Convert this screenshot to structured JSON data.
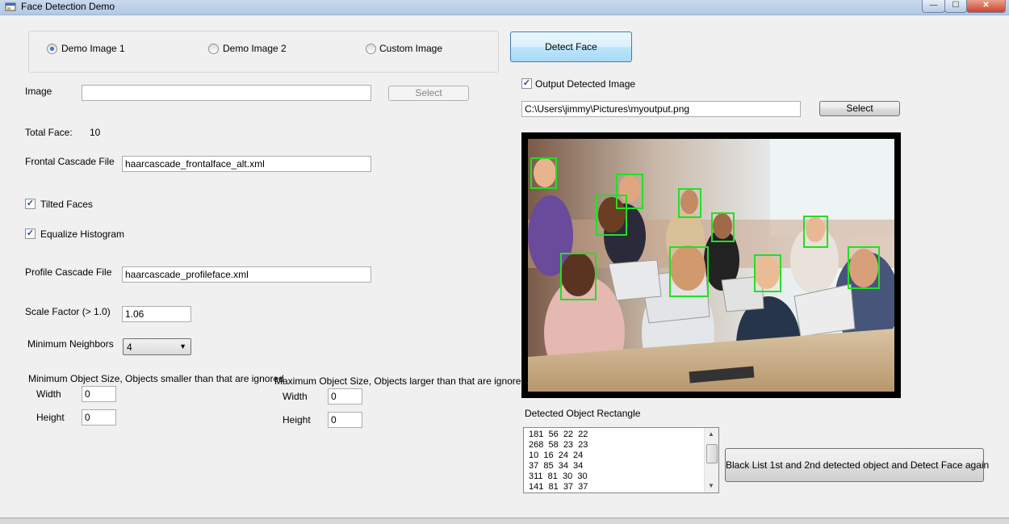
{
  "window": {
    "title": "Face Detection Demo",
    "minimize_glyph": "—",
    "maximize_glyph": "☐",
    "close_glyph": "✕"
  },
  "source": {
    "options": [
      "Demo Image 1",
      "Demo Image 2",
      "Custom Image"
    ],
    "selected": "Demo Image 1"
  },
  "detect_button": "Detect Face",
  "image": {
    "label": "Image",
    "value": "",
    "select_label": "Select"
  },
  "total_face": {
    "label": "Total Face:",
    "value": "10"
  },
  "frontal": {
    "label": "Frontal Cascade File",
    "value": "haarcascade_frontalface_alt.xml"
  },
  "tilted": {
    "label": "Tilted Faces",
    "checked": true
  },
  "equalize": {
    "label": "Equalize Histogram",
    "checked": true
  },
  "profile": {
    "label": "Profile Cascade File",
    "value": "haarcascade_profileface.xml"
  },
  "scale": {
    "label": "Scale Factor (> 1.0)",
    "value": "1.06"
  },
  "neighbors": {
    "label": "Minimum Neighbors",
    "value": "4"
  },
  "min_size": {
    "caption": "Minimum Object Size, Objects smaller than that are ignored",
    "width_label": "Width",
    "width": "0",
    "height_label": "Height",
    "height": "0"
  },
  "max_size": {
    "caption": "Maximum Object Size, Objects larger than that are ignored",
    "width_label": "Width",
    "width": "0",
    "height_label": "Height",
    "height": "0"
  },
  "output": {
    "label": "Output Detected Image",
    "checked": true,
    "path": "C:\\Users\\jimmy\\Pictures\\myoutput.png",
    "select_label": "Select"
  },
  "detected": {
    "label": "Detected Object Rectangle",
    "rows": [
      "181  56  22  22",
      "268  58  23  23",
      "10  16  24  24",
      "37  85  34  34",
      "311  81  30  30",
      "141  81  37  37"
    ]
  },
  "blacklist_button": "Black List 1st and 2nd detected object and Detect Face again",
  "colors": {
    "face_box": "#22e022",
    "focused_button_border": "#3c7fb1"
  }
}
